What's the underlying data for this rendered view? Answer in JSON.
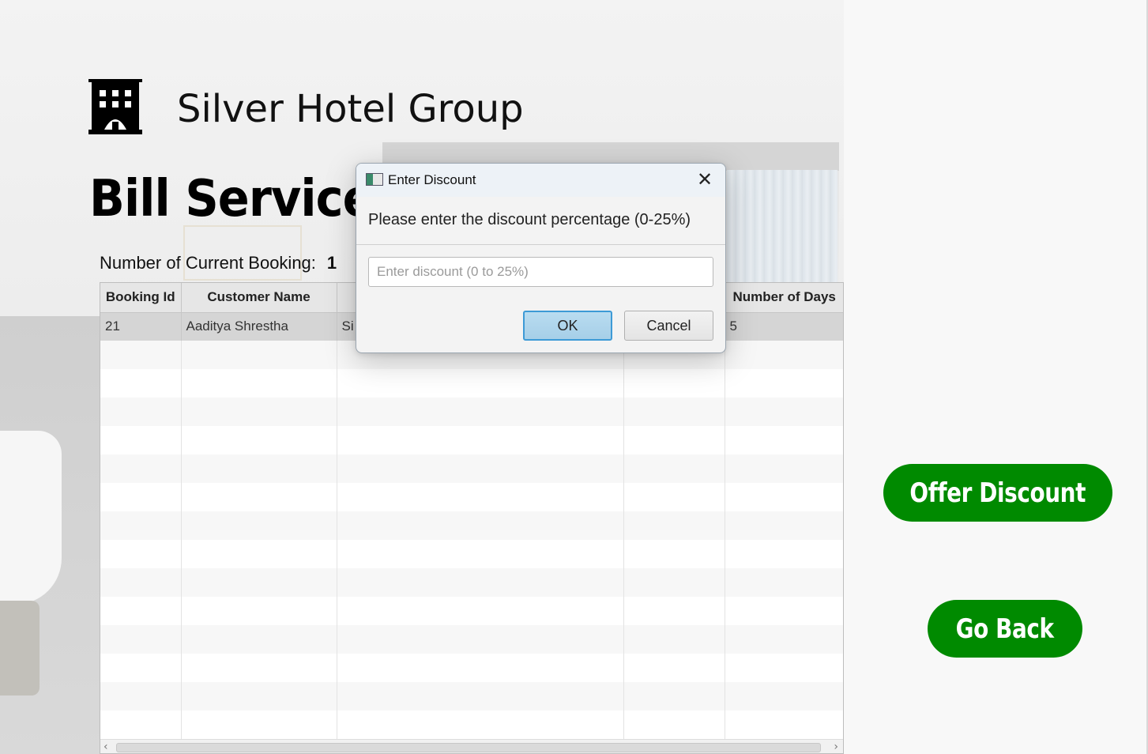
{
  "header": {
    "brand_name": "Silver Hotel Group",
    "page_title": "Bill Service"
  },
  "booking_count": {
    "label": "Number of Current Booking:",
    "value": "1"
  },
  "table": {
    "columns": [
      "Booking Id",
      "Customer Name",
      "",
      "",
      "Number of Days"
    ],
    "rows": [
      [
        "21",
        "Aaditya Shrestha",
        "Si",
        "",
        "5"
      ]
    ]
  },
  "actions": {
    "offer_discount": "Offer Discount",
    "go_back": "Go Back"
  },
  "dialog": {
    "title": "Enter Discount",
    "close_glyph": "✕",
    "message": "Please enter the discount percentage (0-25%)",
    "input_value": "",
    "input_placeholder": "Enter discount (0 to 25%)",
    "ok_label": "OK",
    "cancel_label": "Cancel"
  },
  "colors": {
    "accent_green": "#008a00",
    "ok_border": "#3d9ad6"
  },
  "icons": {
    "brand": "hotel-building-icon",
    "dialog_app": "java-app-icon"
  }
}
